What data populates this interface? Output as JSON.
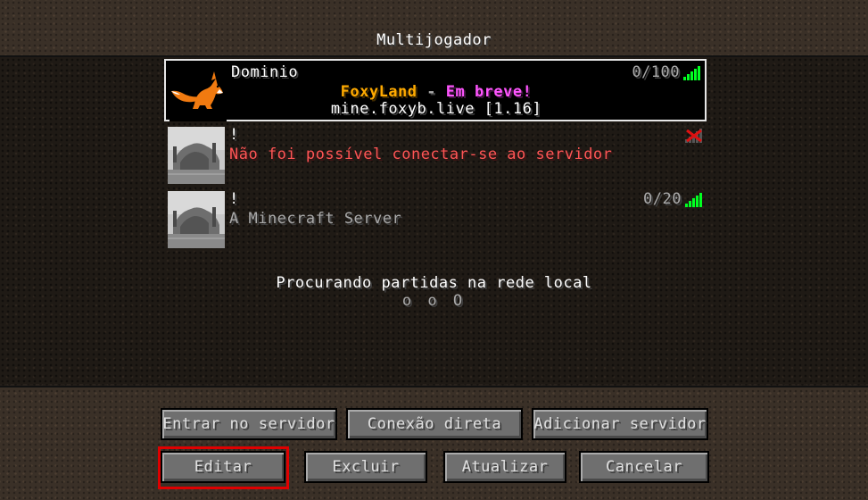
{
  "header": {
    "title": "Multijogador"
  },
  "servers": [
    {
      "name": "Dominio",
      "motd_line1_part1": "FoxyLand",
      "motd_line1_sep": " - ",
      "motd_line1_part2": "Em breve!",
      "motd_line2": "mine.foxyb.live [1.16]",
      "players": "0/100",
      "signal": "full",
      "icon": "fox-icon",
      "selected": true
    },
    {
      "name": "!",
      "motd": "Não foi possível conectar-se ao servidor",
      "players": "",
      "signal": "error",
      "icon": "default-server-icon",
      "selected": false
    },
    {
      "name": "!",
      "motd": "A Minecraft Server",
      "players": "0/20",
      "signal": "full",
      "icon": "default-server-icon",
      "selected": false
    }
  ],
  "lan": {
    "searching": "Procurando partidas na rede local",
    "dots": "o o O"
  },
  "buttons": {
    "join": "Entrar no servidor",
    "direct": "Conexão direta",
    "add": "Adicionar servidor",
    "edit": "Editar",
    "delete": "Excluir",
    "refresh": "Atualizar",
    "cancel": "Cancelar"
  },
  "colors": {
    "motd_orange": "#ffaa00",
    "motd_magenta": "#ff55ff",
    "error_red": "#ff5555",
    "gray_text": "#aaaaaa",
    "highlight": "#e00000"
  }
}
